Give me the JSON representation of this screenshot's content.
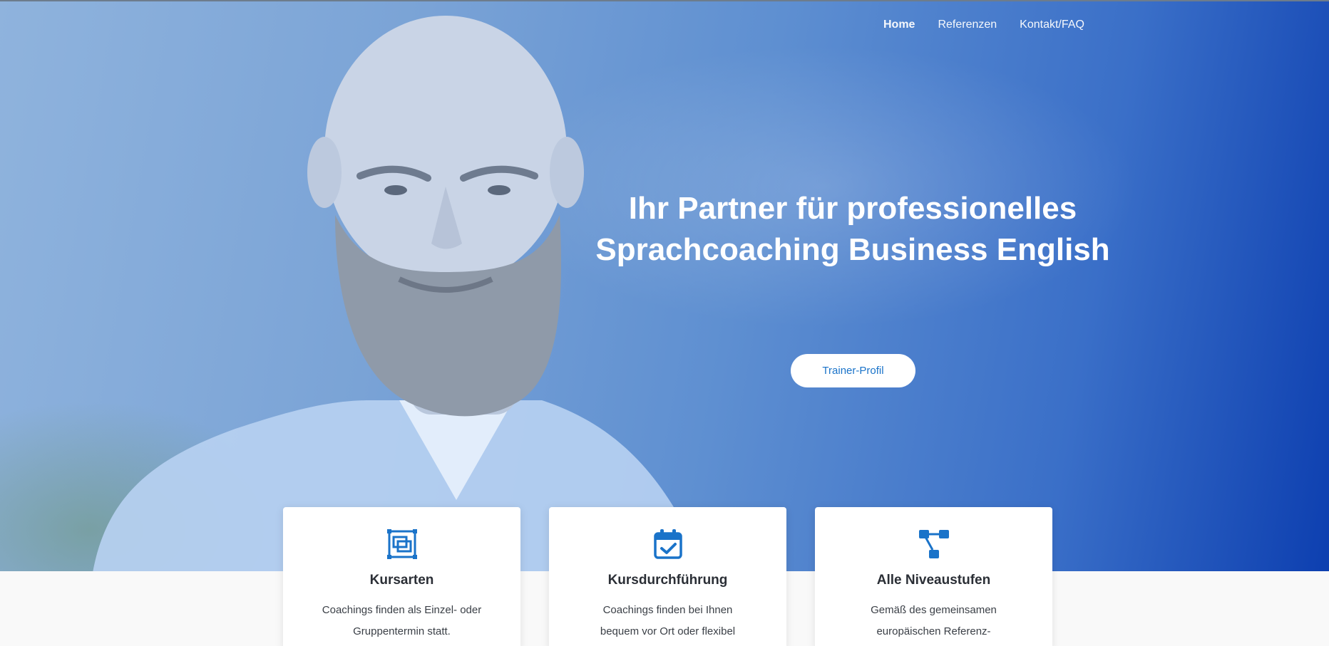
{
  "nav": {
    "items": [
      {
        "label": "Home"
      },
      {
        "label": "Referenzen"
      },
      {
        "label": "Kontakt/FAQ"
      }
    ]
  },
  "hero": {
    "headline": "Ihr Partner für professionelles Sprachcoaching Business English",
    "cta_label": "Trainer-Profil"
  },
  "cards": [
    {
      "icon": "layers-icon",
      "title": "Kursarten",
      "text": "Coachings finden als Einzel- oder Gruppentermin statt."
    },
    {
      "icon": "calendar-check-icon",
      "title": "Kursdurchführung",
      "text": "Coachings finden bei Ihnen bequem vor Ort oder flexibel"
    },
    {
      "icon": "sitemap-icon",
      "title": "Alle Niveaustufen",
      "text": "Gemäß des gemeinsamen europäischen Referenz-"
    }
  ],
  "colors": {
    "accent": "#1a73c9",
    "hero_dark": "#0d3fb0",
    "hero_light": "#8fb3dd"
  }
}
